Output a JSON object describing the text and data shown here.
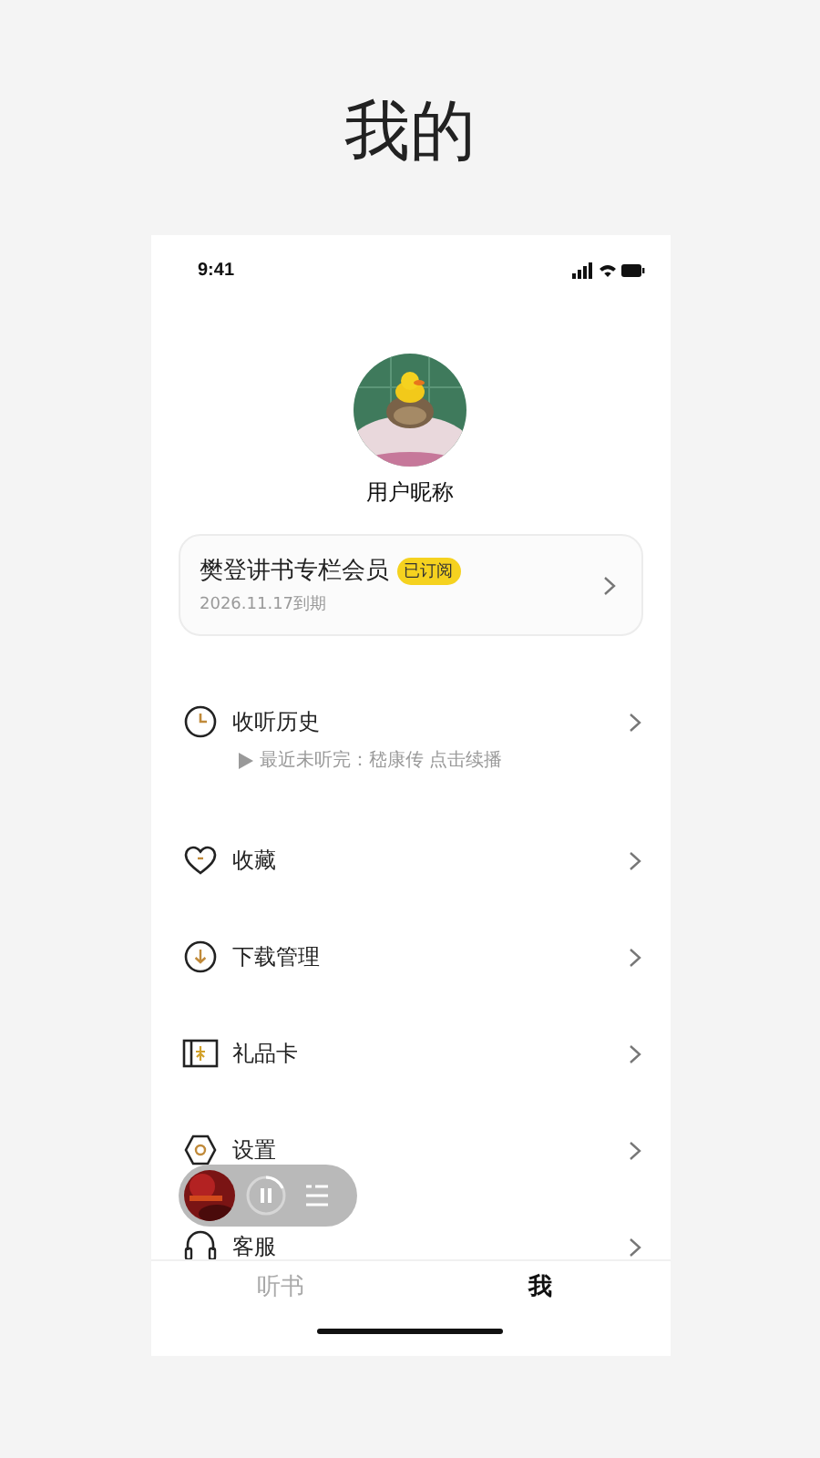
{
  "page_title": "我的",
  "status_bar": {
    "time": "9:41"
  },
  "profile": {
    "nickname": "用户昵称"
  },
  "membership": {
    "title": "樊登讲书专栏会员",
    "badge": "已订阅",
    "expiry": "2026.11.17到期"
  },
  "menu": [
    {
      "kind": "history",
      "label": "收听历史",
      "hint": "最近未听完：嵇康传 点击续播"
    },
    {
      "kind": "favorites",
      "label": "收藏"
    },
    {
      "kind": "download",
      "label": "下载管理"
    },
    {
      "kind": "giftcard",
      "label": "礼品卡"
    },
    {
      "kind": "settings",
      "label": "设置"
    },
    {
      "kind": "service",
      "label": "客服"
    }
  ],
  "mini_player": {
    "playing": true
  },
  "tabs": [
    {
      "label": "听书",
      "selected": false
    },
    {
      "label": "我",
      "selected": true
    }
  ]
}
